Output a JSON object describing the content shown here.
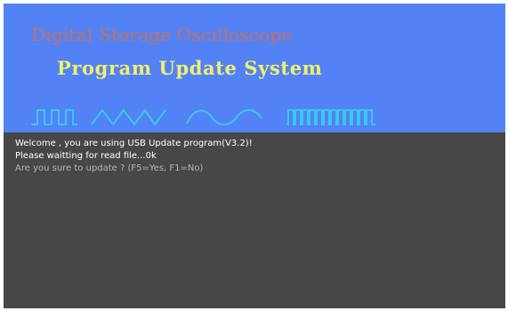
{
  "banner": {
    "brand": "Digital Storage Oscilloscope",
    "title": "Program Update System",
    "wave_icons": [
      "square-wave-icon",
      "triangle-wave-icon",
      "sine-wave-icon",
      "pulse-train-icon"
    ],
    "colors": {
      "background": "#5282f5",
      "brand_text": "#c86f60",
      "title_text": "#f1f06a",
      "waves": "#39c9ea"
    }
  },
  "console": {
    "background": "#474747",
    "lines": [
      "Welcome , you are using USB Update program(V3.2)!",
      "Please waitting for read file...0k",
      "Are you sure to update ? (F5=Yes, F1=No)"
    ],
    "colors": {
      "text": "#ffffff",
      "prompt": "#b6b6b6"
    }
  }
}
